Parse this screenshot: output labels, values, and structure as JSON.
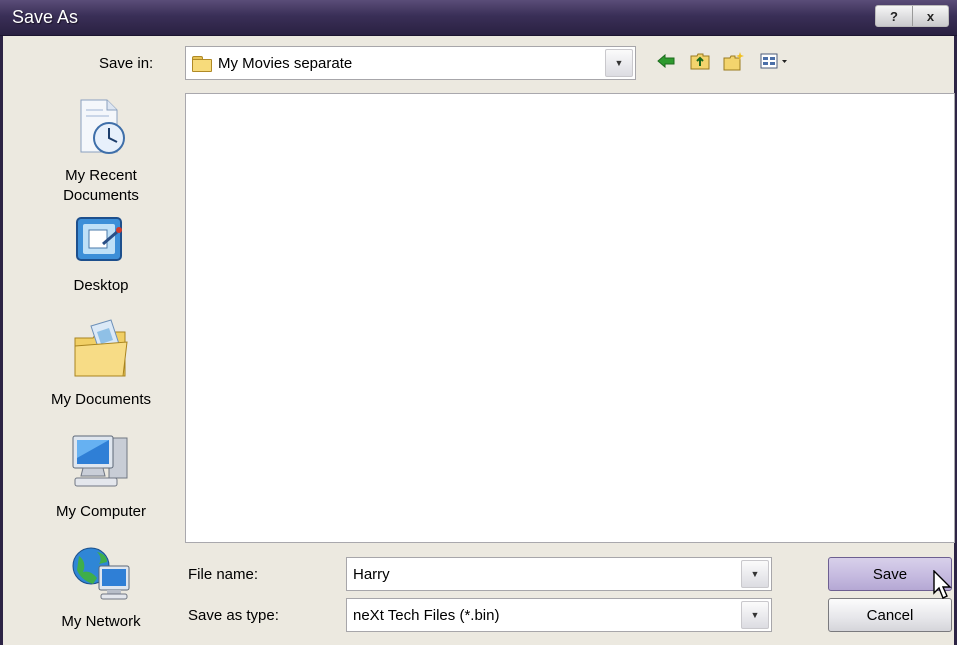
{
  "window": {
    "title": "Save As",
    "help_button": "?",
    "close_button": "x"
  },
  "save_in": {
    "label": "Save in:",
    "value": "My Movies separate"
  },
  "places": [
    {
      "label_line1": "My Recent",
      "label_line2": "Documents",
      "icon": "recent-documents-icon"
    },
    {
      "label_line1": "Desktop",
      "label_line2": "",
      "icon": "desktop-icon"
    },
    {
      "label_line1": "My Documents",
      "label_line2": "",
      "icon": "my-documents-icon"
    },
    {
      "label_line1": "My Computer",
      "label_line2": "",
      "icon": "my-computer-icon"
    },
    {
      "label_line1": "My Network",
      "label_line2": "",
      "icon": "my-network-icon"
    }
  ],
  "form": {
    "file_name_label": "File name:",
    "file_name_value": "Harry",
    "save_as_type_label": "Save as type:",
    "save_as_type_value": "neXt Tech Files (*.bin)"
  },
  "buttons": {
    "save": "Save",
    "cancel": "Cancel"
  },
  "toolbar_icons": [
    "back-icon",
    "up-folder-icon",
    "new-folder-icon",
    "view-menu-icon"
  ]
}
